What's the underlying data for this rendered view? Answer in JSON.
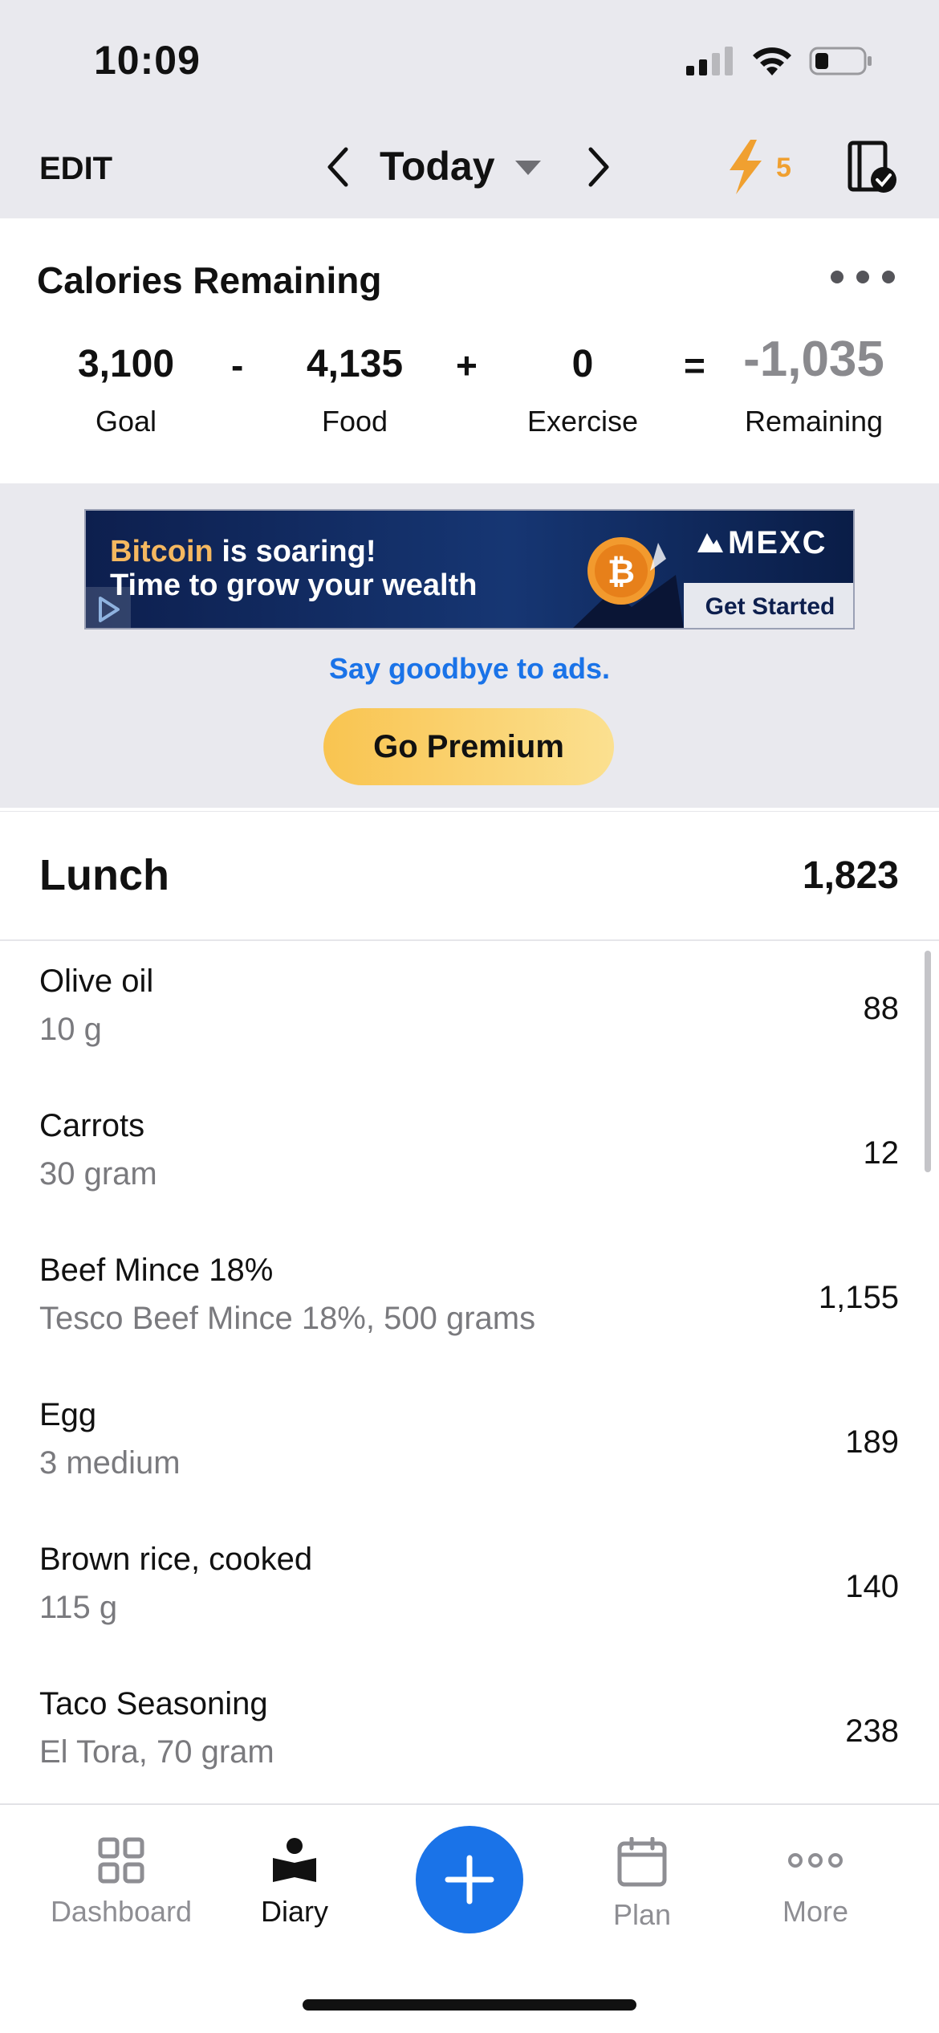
{
  "status_bar": {
    "time": "10:09",
    "battery_icon": "battery-icon",
    "signal_icon": "signal-icon",
    "wifi_icon": "wifi-icon"
  },
  "top_nav": {
    "edit_label": "EDIT",
    "date_label": "Today",
    "streak_count": "5",
    "prev_icon": "chevron-left-icon",
    "next_icon": "chevron-right-icon",
    "dropdown_icon": "caret-down-icon",
    "streak_icon": "lightning-icon",
    "plan_icon": "checked-book-icon"
  },
  "calories": {
    "title": "Calories Remaining",
    "goal": "3,100",
    "goal_label": "Goal",
    "op_minus": "-",
    "food": "4,135",
    "food_label": "Food",
    "op_plus": "+",
    "exercise": "0",
    "exercise_label": "Exercise",
    "op_equals": "=",
    "remaining": "-1,035",
    "remaining_label": "Remaining"
  },
  "ad": {
    "highlight": "Bitcoin",
    "line1_rest": " is soaring!",
    "line2": "Time to grow your wealth",
    "brand": "MEXC",
    "cta": "Get Started",
    "goodbye_label": "Say goodbye to ads.",
    "premium_label": "Go Premium"
  },
  "meal": {
    "name": "Lunch",
    "total": "1,823",
    "items": [
      {
        "name": "Olive oil",
        "detail": "10 g",
        "calories": "88"
      },
      {
        "name": "Carrots",
        "detail": "30 gram",
        "calories": "12"
      },
      {
        "name": "Beef Mince 18%",
        "detail": "Tesco Beef Mince 18%, 500 grams",
        "calories": "1,155"
      },
      {
        "name": "Egg",
        "detail": "3 medium",
        "calories": "189"
      },
      {
        "name": "Brown rice, cooked",
        "detail": "115 g",
        "calories": "140"
      },
      {
        "name": "Taco Seasoning",
        "detail": "El Tora, 70 gram",
        "calories": "238"
      }
    ]
  },
  "tab_bar": {
    "tabs": [
      {
        "label": "Dashboard",
        "icon": "dashboard-grid-icon"
      },
      {
        "label": "Diary",
        "icon": "diary-reader-icon"
      },
      {
        "label": "Plan",
        "icon": "calendar-icon"
      },
      {
        "label": "More",
        "icon": "more-dots-icon"
      }
    ],
    "active_tab": "Diary",
    "add_icon": "plus-icon"
  },
  "colors": {
    "accent": "#1a73e8",
    "streak": "#f0a030",
    "premium": "#f9c450",
    "header_bg": "#e9e9ee"
  }
}
